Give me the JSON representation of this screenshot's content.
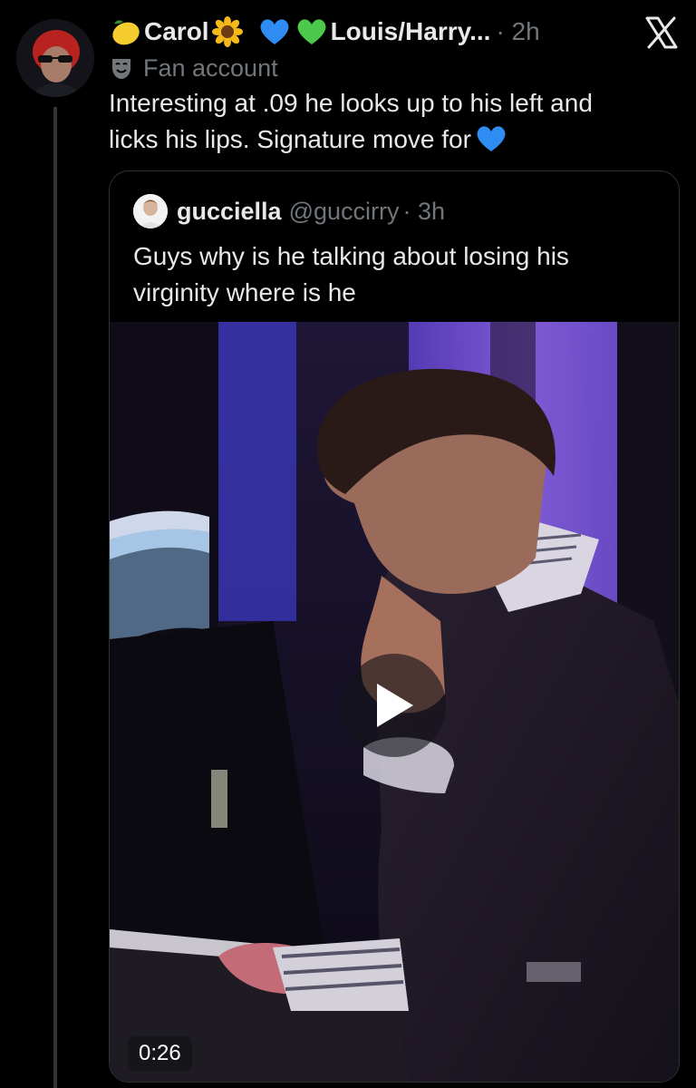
{
  "tweet": {
    "author": {
      "name": "Carol",
      "name_emoji_before": "lemon-icon",
      "name_emoji_after": "sunflower-icon",
      "hearts": [
        "blue-heart-icon",
        "green-heart-icon"
      ],
      "display_suffix": "Louis/Harry...",
      "time": "· 2h",
      "label_icon": "fan-mask-icon",
      "label": "Fan account"
    },
    "text_lines": [
      "Interesting at .09 he looks up to his left and",
      "licks his lips.  Signature move for"
    ],
    "text_trailing_icon": "blue-heart-icon",
    "close_icon": "x-logo-icon"
  },
  "quote": {
    "name": "gucciella",
    "handle": "@guccirry",
    "time": "· 3h",
    "text_lines": [
      "Guys why is he talking about losing his",
      "virginity where is he"
    ],
    "video": {
      "duration": "0:26",
      "play_icon": "play-icon"
    }
  },
  "colors": {
    "background": "#000000",
    "text_primary": "#e7e9ea",
    "text_secondary": "#71767b",
    "border": "#2f3336",
    "blue_heart": "#2f8cf3",
    "green_heart": "#4cc94a",
    "stage_purple": "#7a52d6"
  }
}
